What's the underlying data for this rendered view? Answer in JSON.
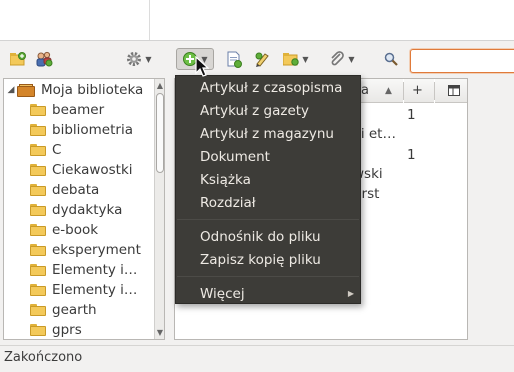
{
  "toolbar": {
    "new_collection_icon": "folder-add-icon",
    "new_group_icon": "group-add-icon",
    "actions_icon": "gear-icon",
    "new_item_icon": "green-plus-icon",
    "add_by_identifier_icon": "document-add-icon",
    "new_note_icon": "pen-icon",
    "attachment_icon": "paperclip-icon",
    "locate_icon": "magnifier-icon",
    "search_value": ""
  },
  "collections": {
    "root": "Moja biblioteka",
    "items": [
      "beamer",
      "bibliometria",
      "C",
      "Ciekawostki",
      "debata",
      "dydaktyka",
      "e-book",
      "eksperyment",
      "Elementy i…",
      "Elementy i…",
      "gearth",
      "gprs"
    ]
  },
  "items_table": {
    "header_title_fragment": "a",
    "header_sort_arrow": "▲",
    "header_plus": "+",
    "rows": [
      {
        "title": "",
        "count": "1"
      },
      {
        "title": "ki et…",
        "count": ""
      },
      {
        "title": "",
        "count": "1"
      },
      {
        "title": "wski",
        "count": ""
      },
      {
        "title": "urst",
        "count": ""
      }
    ]
  },
  "new_item_menu": {
    "items": [
      "Artykuł z czasopisma",
      "Artykuł z gazety",
      "Artykuł z magazynu",
      "Dokument",
      "Książka",
      "Rozdział"
    ],
    "attachment_items": [
      "Odnośnik do pliku",
      "Zapisz kopię pliku"
    ],
    "more": "Więcej"
  },
  "status": {
    "text": "Zakończono"
  },
  "colors": {
    "menu_bg": "#3d3c38",
    "menu_text": "#eeeae4",
    "search_focus": "#e07a3a",
    "window_bg": "#f2f1f0"
  }
}
